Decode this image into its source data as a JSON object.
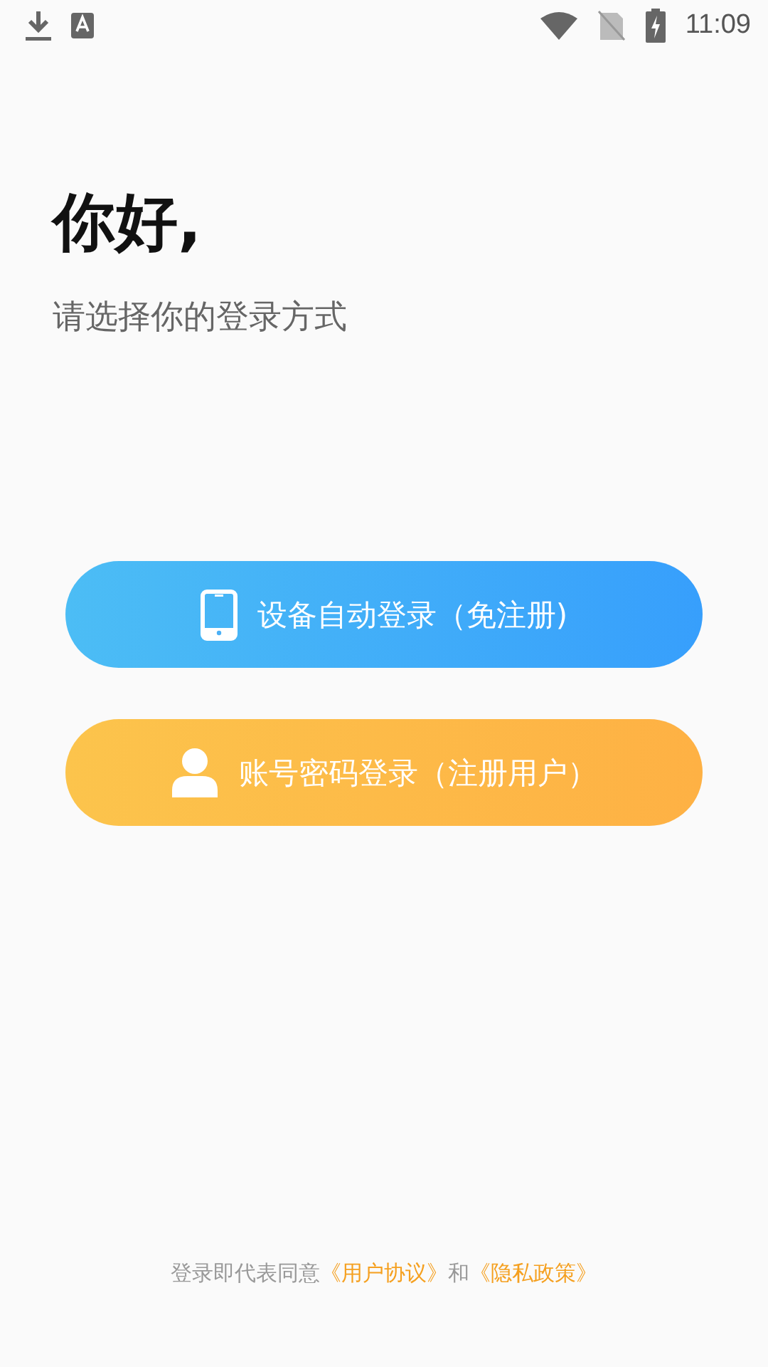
{
  "status_bar": {
    "time": "11:09"
  },
  "greeting": {
    "title": "你好,",
    "subtitle": "请选择你的登录方式"
  },
  "login_options": [
    {
      "kind": "device",
      "label": "设备自动登录（免注册)"
    },
    {
      "kind": "account",
      "label": "账号密码登录（注册用户）"
    }
  ],
  "footer": {
    "text": "登录即代表同意",
    "links": [
      "《用户协议》",
      "《隐私政策》"
    ],
    "joiner": "和"
  }
}
